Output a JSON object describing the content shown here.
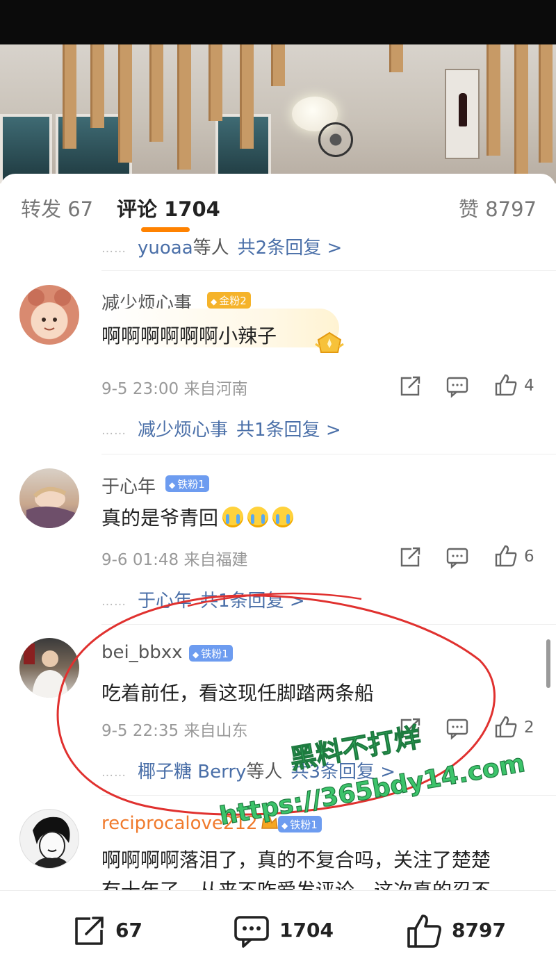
{
  "tabs": {
    "reposts": "转发 67",
    "comments": "评论 1704",
    "likes": "赞 8797"
  },
  "replies_top": {
    "dots": "……",
    "name": "yuoaa",
    "suffix": "等人",
    "total": "共2条回复 >"
  },
  "comments": [
    {
      "user": "减少烦心事",
      "badge": "金粉2",
      "text": "啊啊啊啊啊啊小辣子",
      "time": "9-5 23:00",
      "location": "来自河南",
      "likes": "4",
      "reply_user": "减少烦心事",
      "reply_total": "共1条回复 >"
    },
    {
      "user": "于心年",
      "badge": "铁粉1",
      "text": "真的是爷青回",
      "time": "9-6 01:48",
      "location": "来自福建",
      "likes": "6",
      "reply_user": "于心年",
      "reply_total": "共1条回复 >"
    },
    {
      "user": "bei_bbxx",
      "badge": "铁粉1",
      "text": "吃着前任，看这现任脚踏两条船",
      "time": "9-5 22:35",
      "location": "来自山东",
      "likes": "2",
      "reply_user": "椰子糖 Berry",
      "reply_suffix": "等人",
      "reply_total": "共3条回复 >"
    },
    {
      "user": "reciprocalove212",
      "badge": "铁粉1",
      "text_line1": "啊啊啊啊落泪了，真的不复合吗，关注了楚楚",
      "text_line2": "有十年了，从来不咋爱发评论，这次真的忍不"
    }
  ],
  "bottom_bar": {
    "reposts": "67",
    "comments": "1704",
    "likes": "8797"
  },
  "watermark": {
    "line1": "黑料不打烊",
    "line2": "https://365bdy14.com"
  },
  "colors": {
    "accent": "#ff8200",
    "link_blue": "#4a6fa8",
    "annotation_red": "#e0312f",
    "watermark_green": "#3cc36a"
  }
}
